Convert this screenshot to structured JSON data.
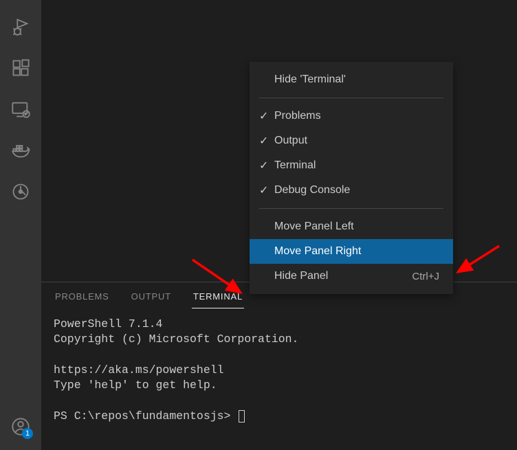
{
  "activity_bar": {
    "badge_count": "1"
  },
  "panel": {
    "tabs": {
      "problems": "PROBLEMS",
      "output": "OUTPUT",
      "terminal": "TERMINAL"
    },
    "terminal": {
      "line1": "PowerShell 7.1.4",
      "line2": "Copyright (c) Microsoft Corporation.",
      "line3": "https://aka.ms/powershell",
      "line4": "Type 'help' to get help.",
      "prompt": "PS C:\\repos\\fundamentosjs> "
    }
  },
  "context_menu": {
    "hide_terminal": "Hide 'Terminal'",
    "problems": "Problems",
    "output": "Output",
    "terminal": "Terminal",
    "debug_console": "Debug Console",
    "move_left": "Move Panel Left",
    "move_right": "Move Panel Right",
    "hide_panel": "Hide Panel",
    "hide_panel_shortcut": "Ctrl+J"
  }
}
